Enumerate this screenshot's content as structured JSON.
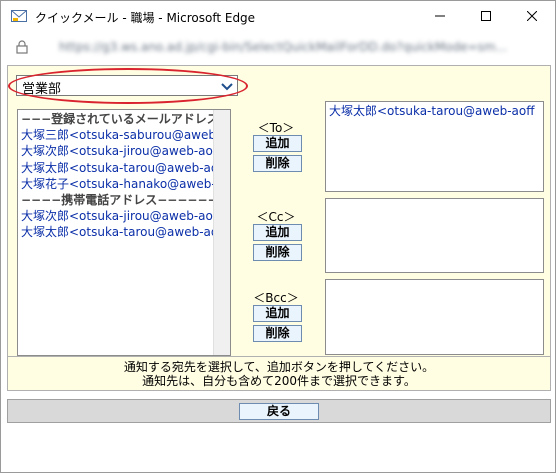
{
  "window": {
    "title": "クイックメール - 職場 - Microsoft Edge",
    "url": "https://g3.ws.ano.ad.jp/cgi-bin/SelectQuickMailForDD.do?quickMode=sm..."
  },
  "department": {
    "selected": "営業部"
  },
  "address_list": [
    {
      "type": "header",
      "text": "−−−登録されているメールアドレス"
    },
    {
      "type": "item",
      "text": "大塚三郎<otsuka-saburou@aweb-aoff"
    },
    {
      "type": "item",
      "text": "大塚次郎<otsuka-jirou@aweb-aoff"
    },
    {
      "type": "item",
      "text": "大塚太郎<otsuka-tarou@aweb-aoff"
    },
    {
      "type": "item",
      "text": "大塚花子<otsuka-hanako@aweb-aoff"
    },
    {
      "type": "header",
      "text": "−−−−携帯電話アドレス−−−−−−−−−−−"
    },
    {
      "type": "item",
      "text": "大塚次郎<otsuka-jirou@aweb-aoff"
    },
    {
      "type": "item",
      "text": "大塚太郎<otsuka-tarou@aweb-aoff"
    }
  ],
  "groups": {
    "to": {
      "label": "＜To＞",
      "add": "追加",
      "remove": "削除",
      "recipients": [
        "大塚太郎<otsuka-tarou@aweb-aoff"
      ]
    },
    "cc": {
      "label": "＜Cc＞",
      "add": "追加",
      "remove": "削除",
      "recipients": []
    },
    "bcc": {
      "label": "＜Bcc＞",
      "add": "追加",
      "remove": "削除",
      "recipients": []
    }
  },
  "info": {
    "line1": "通知する宛先を選択して、追加ボタンを押してください。",
    "line2": "通知先は、自分も含めて200件まで選択できます。"
  },
  "footer": {
    "back_label": "戻る"
  },
  "icons": {
    "app": "mail-app-icon",
    "lock": "lock-icon",
    "minimize": "minimize-icon",
    "maximize": "maximize-icon",
    "close": "close-icon",
    "dropdown": "chevron-down-icon"
  },
  "colors": {
    "panel_bg": "#fffde2",
    "button_bg": "#eaf4fd",
    "button_border": "#6d8cb0",
    "highlight_ring": "#d9232e",
    "list_text": "#0b2fa8"
  }
}
